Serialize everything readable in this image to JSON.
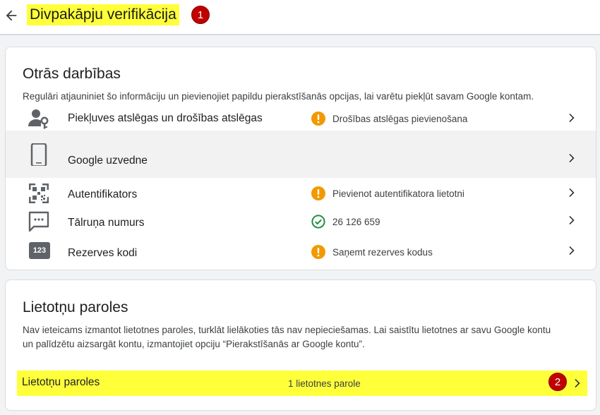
{
  "header": {
    "title": "Divpakāpju verifikācija",
    "marker": "1"
  },
  "other_steps": {
    "title": "Otrās darbības",
    "description": "Regulāri atjauniniet šo informāciju un pievienojiet papildu pierakstīšanās opcijas, lai varētu piekļūt savam Google kontam.",
    "items": [
      {
        "label": "Piekļuves atslēgas un drošības atslēgas",
        "status": "Drošības atslēgas pievienošana",
        "status_type": "warning",
        "icon": "passkey-icon"
      },
      {
        "label": "Google uzvedne",
        "status": "",
        "status_type": "none",
        "icon": "phone-icon"
      },
      {
        "label": "Autentifikators",
        "status": "Pievienot autentifikatora lietotni",
        "status_type": "warning",
        "icon": "qr-code-icon"
      },
      {
        "label": "Tālruņa numurs",
        "status": "26 126 659",
        "status_type": "ok",
        "icon": "message-icon"
      },
      {
        "label": "Rezerves kodi",
        "status": "Saņemt rezerves kodus",
        "status_type": "warning",
        "icon": "backup-codes-icon",
        "icon_text": "123"
      }
    ]
  },
  "app_passwords": {
    "title": "Lietotņu paroles",
    "description_line1": "Nav ieteicams izmantot lietotnes paroles, turklāt lielākoties tās nav nepieciešamas. Lai saistītu lietotnes ar savu Google kontu",
    "description_line2": "un palīdzētu aizsargāt kontu, izmantojiet opciju “Pierakstīšanās ar Google kontu”.",
    "row_label": "Lietotņu paroles",
    "row_value": "1 lietotnes parole",
    "marker": "2"
  },
  "colors": {
    "highlight": "#ffff3a",
    "warning": "#f29900",
    "ok": "#1e8e3e",
    "marker": "#c00000"
  }
}
